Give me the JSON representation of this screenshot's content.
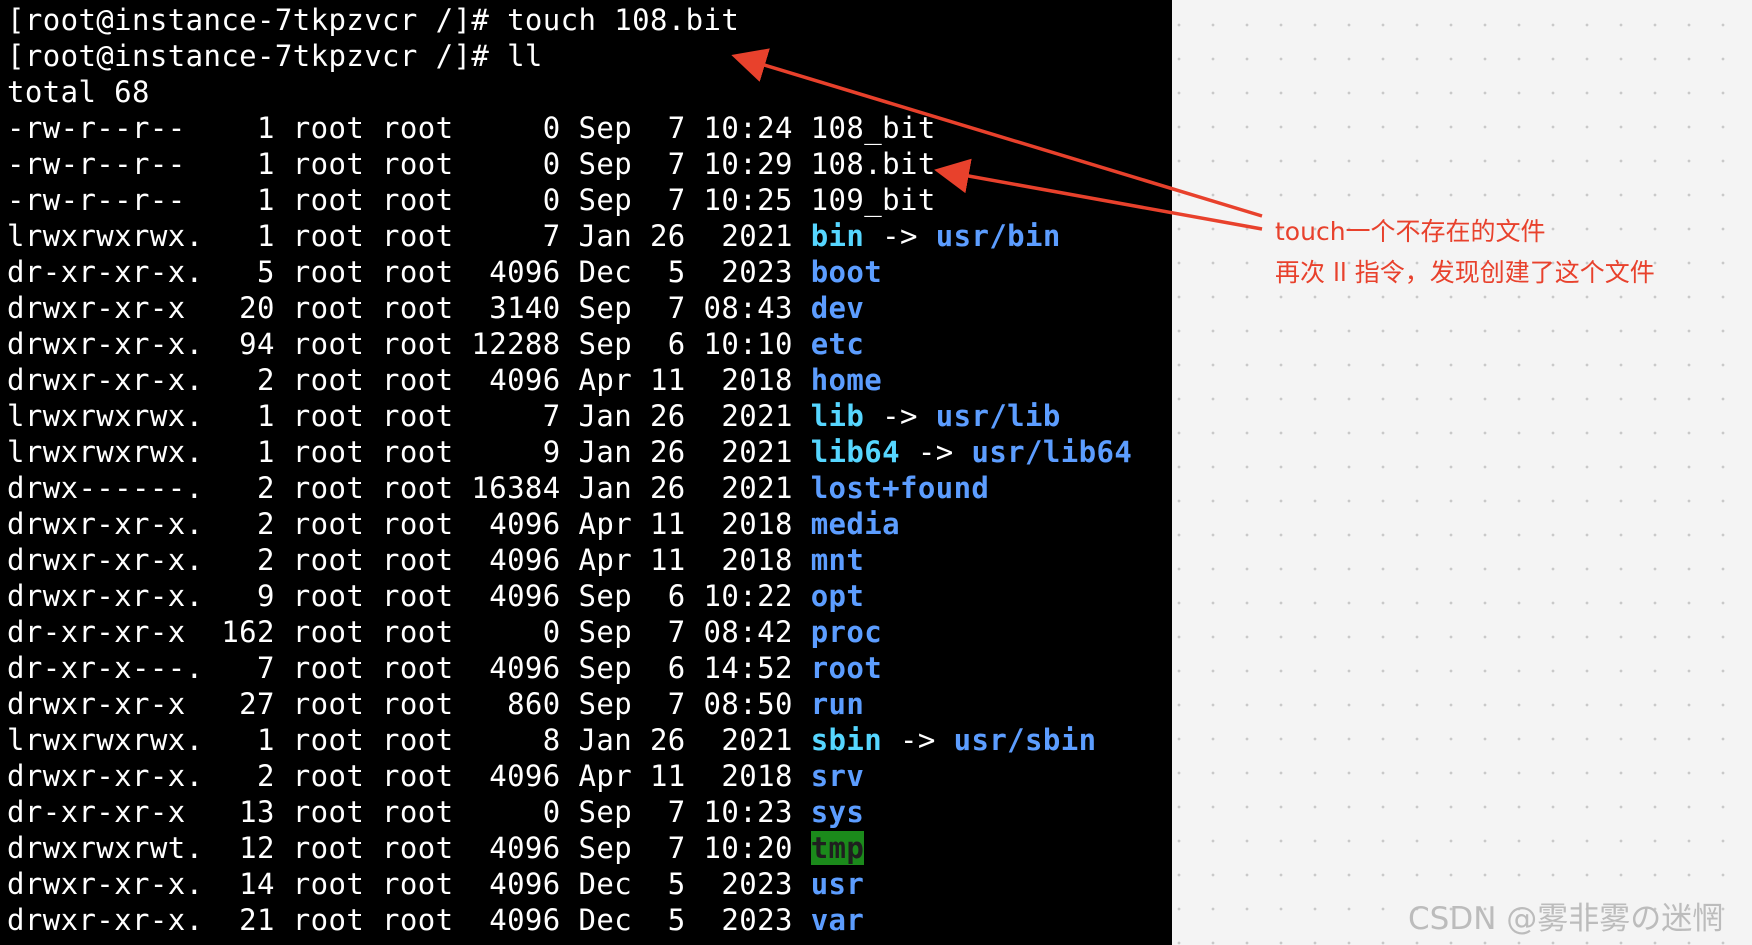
{
  "terminal": {
    "lines": [
      {
        "segments": [
          {
            "text": "[root@instance-7tkpzvcr /]# touch 108.bit",
            "style": "plain"
          }
        ]
      },
      {
        "segments": [
          {
            "text": "[root@instance-7tkpzvcr /]# ll",
            "style": "plain"
          }
        ]
      },
      {
        "segments": [
          {
            "text": "total 68",
            "style": "plain"
          }
        ]
      },
      {
        "segments": [
          {
            "text": "-rw-r--r--    1 root root     0 Sep  7 10:24 108_bit",
            "style": "plain"
          }
        ]
      },
      {
        "segments": [
          {
            "text": "-rw-r--r--    1 root root     0 Sep  7 10:29 108.bit",
            "style": "plain"
          }
        ]
      },
      {
        "segments": [
          {
            "text": "-rw-r--r--    1 root root     0 Sep  7 10:25 109_bit",
            "style": "plain"
          }
        ]
      },
      {
        "segments": [
          {
            "text": "lrwxrwxrwx.   1 root root     7 Jan 26  2021 ",
            "style": "plain"
          },
          {
            "text": "bin",
            "style": "lnk"
          },
          {
            "text": " -> ",
            "style": "plain"
          },
          {
            "text": "usr/bin",
            "style": "dir"
          }
        ]
      },
      {
        "segments": [
          {
            "text": "dr-xr-xr-x.   5 root root  4096 Dec  5  2023 ",
            "style": "plain"
          },
          {
            "text": "boot",
            "style": "dir"
          }
        ]
      },
      {
        "segments": [
          {
            "text": "drwxr-xr-x   20 root root  3140 Sep  7 08:43 ",
            "style": "plain"
          },
          {
            "text": "dev",
            "style": "dir"
          }
        ]
      },
      {
        "segments": [
          {
            "text": "drwxr-xr-x.  94 root root 12288 Sep  6 10:10 ",
            "style": "plain"
          },
          {
            "text": "etc",
            "style": "dir"
          }
        ]
      },
      {
        "segments": [
          {
            "text": "drwxr-xr-x.   2 root root  4096 Apr 11  2018 ",
            "style": "plain"
          },
          {
            "text": "home",
            "style": "dir"
          }
        ]
      },
      {
        "segments": [
          {
            "text": "lrwxrwxrwx.   1 root root     7 Jan 26  2021 ",
            "style": "plain"
          },
          {
            "text": "lib",
            "style": "lnk"
          },
          {
            "text": " -> ",
            "style": "plain"
          },
          {
            "text": "usr/lib",
            "style": "dir"
          }
        ]
      },
      {
        "segments": [
          {
            "text": "lrwxrwxrwx.   1 root root     9 Jan 26  2021 ",
            "style": "plain"
          },
          {
            "text": "lib64",
            "style": "lnk"
          },
          {
            "text": " -> ",
            "style": "plain"
          },
          {
            "text": "usr/lib64",
            "style": "dir"
          }
        ]
      },
      {
        "segments": [
          {
            "text": "drwx------.   2 root root 16384 Jan 26  2021 ",
            "style": "plain"
          },
          {
            "text": "lost+found",
            "style": "dir"
          }
        ]
      },
      {
        "segments": [
          {
            "text": "drwxr-xr-x.   2 root root  4096 Apr 11  2018 ",
            "style": "plain"
          },
          {
            "text": "media",
            "style": "dir"
          }
        ]
      },
      {
        "segments": [
          {
            "text": "drwxr-xr-x.   2 root root  4096 Apr 11  2018 ",
            "style": "plain"
          },
          {
            "text": "mnt",
            "style": "dir"
          }
        ]
      },
      {
        "segments": [
          {
            "text": "drwxr-xr-x.   9 root root  4096 Sep  6 10:22 ",
            "style": "plain"
          },
          {
            "text": "opt",
            "style": "dir"
          }
        ]
      },
      {
        "segments": [
          {
            "text": "dr-xr-xr-x  162 root root     0 Sep  7 08:42 ",
            "style": "plain"
          },
          {
            "text": "proc",
            "style": "dir"
          }
        ]
      },
      {
        "segments": [
          {
            "text": "dr-xr-x---.   7 root root  4096 Sep  6 14:52 ",
            "style": "plain"
          },
          {
            "text": "root",
            "style": "dir"
          }
        ]
      },
      {
        "segments": [
          {
            "text": "drwxr-xr-x   27 root root   860 Sep  7 08:50 ",
            "style": "plain"
          },
          {
            "text": "run",
            "style": "dir"
          }
        ]
      },
      {
        "segments": [
          {
            "text": "lrwxrwxrwx.   1 root root     8 Jan 26  2021 ",
            "style": "plain"
          },
          {
            "text": "sbin",
            "style": "lnk"
          },
          {
            "text": " -> ",
            "style": "plain"
          },
          {
            "text": "usr/sbin",
            "style": "dir"
          }
        ]
      },
      {
        "segments": [
          {
            "text": "drwxr-xr-x.   2 root root  4096 Apr 11  2018 ",
            "style": "plain"
          },
          {
            "text": "srv",
            "style": "dir"
          }
        ]
      },
      {
        "segments": [
          {
            "text": "dr-xr-xr-x   13 root root     0 Sep  7 10:23 ",
            "style": "plain"
          },
          {
            "text": "sys",
            "style": "dir"
          }
        ]
      },
      {
        "segments": [
          {
            "text": "drwxrwxrwt.  12 root root  4096 Sep  7 10:20 ",
            "style": "plain"
          },
          {
            "text": "tmp",
            "style": "tmp"
          }
        ]
      },
      {
        "segments": [
          {
            "text": "drwxr-xr-x.  14 root root  4096 Dec  5  2023 ",
            "style": "plain"
          },
          {
            "text": "usr",
            "style": "dir"
          }
        ]
      },
      {
        "segments": [
          {
            "text": "drwxr-xr-x.  21 root root  4096 Dec  5  2023 ",
            "style": "plain"
          },
          {
            "text": "var",
            "style": "dir"
          }
        ]
      }
    ]
  },
  "annotation": {
    "line1": "touch一个不存在的文件",
    "line2": "再次 ll 指令，发现创建了这个文件",
    "color": "#e8412c"
  },
  "watermark": "CSDN @雾非雾の迷惘",
  "colors": {
    "terminal_bg": "#000000",
    "text": "#ffffff",
    "dir": "#5c9dff",
    "link": "#56d6ff",
    "tmp_bg": "#1b8a1b",
    "arrow": "#e8412c"
  }
}
